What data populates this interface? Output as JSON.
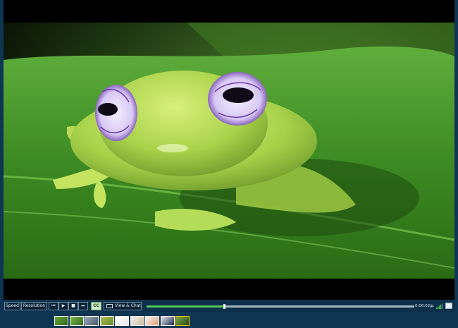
{
  "controls": {
    "speed_label": "Speed",
    "resolution_label": "Resolution",
    "skip_back_glyph": "⏮",
    "play_glyph": "▶",
    "stop_glyph": "■",
    "skip_forward_glyph": "⏭",
    "cc_label": "CC",
    "view_chat_label": "View & Chat",
    "time": "0:00:02",
    "volume_glyph": "🔈"
  },
  "playback": {
    "progress_fraction": 0.29,
    "volume_fraction": 0.8
  },
  "thumbnails": {
    "count": 9,
    "active_index": 8
  },
  "colors": {
    "page_background": "#0e3552",
    "progress_fill": "#4fc65a",
    "cc_background": "#cfe9c6"
  }
}
